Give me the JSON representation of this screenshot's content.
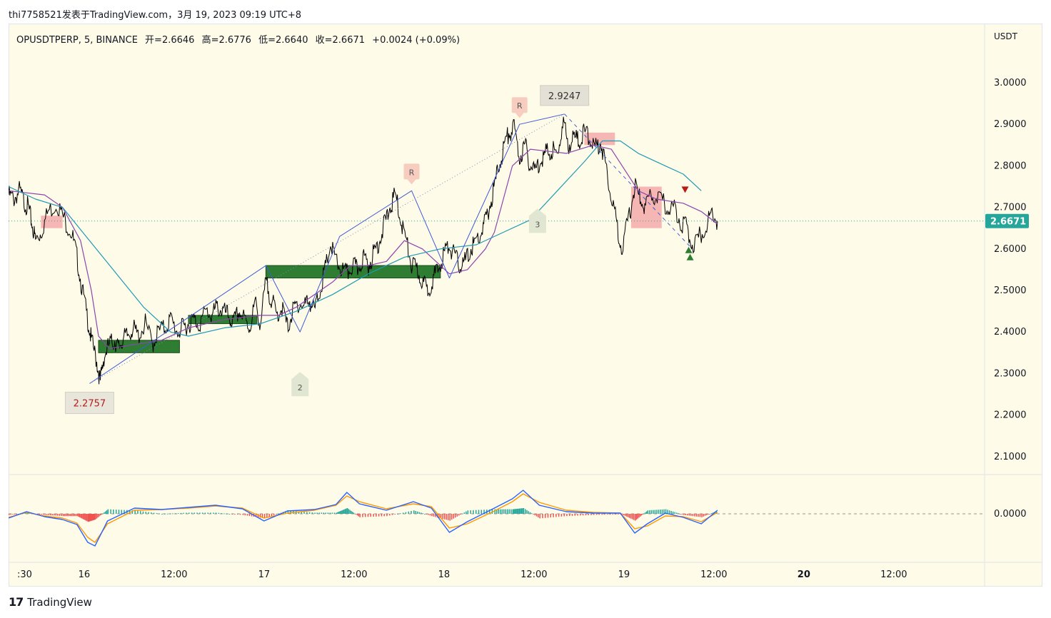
{
  "caption": "thi7758521发表于TradingView.com，3月 19, 2023 09:19 UTC+8",
  "legend": {
    "symbol": "OPUSDTPERP, 5, BINANCE",
    "open": "开=2.6646",
    "high": "高=2.6776",
    "low": "低=2.6640",
    "close": "收=2.6671",
    "change": "+0.0024 (+0.09%)"
  },
  "currency": "USDT",
  "last_price": "2.6671",
  "footer_brand": "TradingView",
  "colors": {
    "background": "#fefbe8",
    "candle": "#000000",
    "ma_fast": "#8e44ad",
    "ma_slow": "#1e9bb5",
    "zigzag": "#3f5bd6",
    "demand_zone": "#2e7d32",
    "supply_zone": "#f4a6a6",
    "price_tag": "#26a69a",
    "macd_line": "#2962ff",
    "signal_line": "#ff9800",
    "hist_up": "#26a69a",
    "hist_down": "#ef5350"
  },
  "chart_data": {
    "type": "line",
    "title": "OPUSDTPERP, 5, BINANCE",
    "ylabel": "USDT",
    "ylim": [
      2.05,
      3.06
    ],
    "y_ticks": [
      "3.0000",
      "2.9000",
      "2.8000",
      "2.7000",
      "2.6000",
      "2.5000",
      "2.4000",
      "2.3000",
      "2.2000",
      "2.1000"
    ],
    "x_ticks": [
      ":30",
      "16",
      "12:00",
      "17",
      "12:00",
      "18",
      "12:00",
      "19",
      "12:00",
      "20",
      "12:00"
    ],
    "x_ticks_bold": [
      "20"
    ],
    "series": [
      {
        "kind": "price",
        "x": [
          0,
          0.03,
          0.06,
          0.09,
          0.11,
          0.13,
          0.15,
          0.18,
          0.22,
          0.27,
          0.31,
          0.35,
          0.38,
          0.41,
          0.44,
          0.46,
          0.49,
          0.51,
          0.53,
          0.56,
          0.59,
          0.61,
          0.63,
          0.66,
          0.69,
          0.72,
          0.76,
          0.8,
          0.83,
          0.87,
          0.9,
          0.94,
          0.97,
          1.0,
          1.03,
          1.06,
          1.1,
          1.13,
          1.16,
          1.19,
          1.22,
          1.25,
          1.28,
          1.31,
          1.34,
          1.37,
          1.4,
          1.43,
          1.46,
          1.49,
          1.52,
          1.55,
          1.58,
          1.61,
          1.64,
          1.67,
          1.7,
          1.73,
          1.76,
          1.79,
          1.82,
          1.85,
          1.88,
          1.91,
          1.94,
          1.97,
          2.0,
          2.03,
          2.06,
          2.09,
          2.12,
          2.15,
          2.18,
          2.21,
          2.24,
          2.27,
          2.3,
          2.33,
          2.36,
          2.39,
          2.42,
          2.45,
          2.48,
          2.51,
          2.54,
          2.57,
          2.6,
          2.63,
          2.66,
          2.69,
          2.72,
          2.75,
          2.78,
          2.81,
          2.84,
          2.87,
          2.9,
          2.93,
          2.96,
          2.99,
          3.02,
          3.05,
          3.08,
          3.11,
          3.14,
          3.17,
          3.2,
          3.23,
          3.26,
          3.29,
          3.32,
          3.35,
          3.38,
          3.41,
          3.45,
          3.48,
          3.51,
          3.54,
          3.58,
          3.62,
          3.66,
          3.7,
          3.73,
          3.77,
          3.8,
          3.84,
          3.88,
          3.91,
          3.94
        ],
        "values": [
          2.73,
          2.72,
          2.74,
          2.71,
          2.7,
          2.66,
          2.62,
          2.64,
          2.69,
          2.71,
          2.67,
          2.64,
          2.58,
          2.5,
          2.43,
          2.38,
          2.33,
          2.28,
          2.34,
          2.37,
          2.38,
          2.36,
          2.38,
          2.39,
          2.41,
          2.39,
          2.42,
          2.37,
          2.4,
          2.41,
          2.43,
          2.4,
          2.41,
          2.42,
          2.43,
          2.42,
          2.45,
          2.44,
          2.46,
          2.45,
          2.44,
          2.42,
          2.45,
          2.43,
          2.41,
          2.47,
          2.42,
          2.52,
          2.48,
          2.44,
          2.46,
          2.41,
          2.45,
          2.47,
          2.46,
          2.48,
          2.45,
          2.5,
          2.55,
          2.61,
          2.57,
          2.55,
          2.54,
          2.56,
          2.55,
          2.58,
          2.56,
          2.59,
          2.62,
          2.66,
          2.7,
          2.73,
          2.67,
          2.62,
          2.56,
          2.55,
          2.52,
          2.5,
          2.53,
          2.55,
          2.59,
          2.61,
          2.58,
          2.56,
          2.57,
          2.6,
          2.62,
          2.64,
          2.68,
          2.73,
          2.79,
          2.84,
          2.88,
          2.89,
          2.82,
          2.85,
          2.8,
          2.79,
          2.82,
          2.83,
          2.84,
          2.82,
          2.91,
          2.85,
          2.87,
          2.86,
          2.88,
          2.87,
          2.84,
          2.86,
          2.8,
          2.73,
          2.66,
          2.6,
          2.68,
          2.75,
          2.72,
          2.7,
          2.73,
          2.72,
          2.7,
          2.7,
          2.67,
          2.65,
          2.61,
          2.63,
          2.66,
          2.69,
          2.667
        ]
      },
      {
        "kind": "ma_fast",
        "x": [
          0,
          0.2,
          0.3,
          0.4,
          0.46,
          0.5,
          0.56,
          0.7,
          0.85,
          1.0,
          1.2,
          1.4,
          1.5,
          1.6,
          1.8,
          1.9,
          2.0,
          2.1,
          2.2,
          2.3,
          2.45,
          2.55,
          2.65,
          2.7,
          2.75,
          2.8,
          2.9,
          3.1,
          3.25,
          3.35,
          3.5,
          3.6,
          3.75,
          3.85,
          3.94
        ],
        "values": [
          2.74,
          2.73,
          2.7,
          2.62,
          2.5,
          2.39,
          2.36,
          2.37,
          2.38,
          2.41,
          2.43,
          2.44,
          2.44,
          2.46,
          2.52,
          2.56,
          2.56,
          2.57,
          2.62,
          2.6,
          2.54,
          2.55,
          2.6,
          2.64,
          2.72,
          2.8,
          2.84,
          2.83,
          2.85,
          2.84,
          2.74,
          2.72,
          2.71,
          2.69,
          2.66
        ]
      },
      {
        "kind": "ma_slow",
        "x": [
          0,
          0.15,
          0.3,
          0.45,
          0.6,
          0.75,
          0.9,
          1.0,
          1.2,
          1.4,
          1.6,
          1.8,
          2.0,
          2.2,
          2.4,
          2.6,
          2.75,
          2.9,
          3.05,
          3.2,
          3.3,
          3.4,
          3.5,
          3.65,
          3.75,
          3.85
        ],
        "values": [
          2.75,
          2.72,
          2.7,
          2.62,
          2.54,
          2.46,
          2.4,
          2.39,
          2.41,
          2.42,
          2.45,
          2.49,
          2.54,
          2.58,
          2.6,
          2.61,
          2.64,
          2.67,
          2.74,
          2.81,
          2.86,
          2.86,
          2.83,
          2.8,
          2.78,
          2.74
        ]
      },
      {
        "kind": "zigzag",
        "x": [
          0.45,
          1.43,
          1.62,
          1.84,
          2.24,
          2.45,
          2.84,
          3.09
        ],
        "values": [
          2.2757,
          2.56,
          2.4,
          2.63,
          2.74,
          2.53,
          2.9,
          2.9247
        ]
      },
      {
        "kind": "trendline_dotted",
        "x": [
          0.45,
          3.09
        ],
        "values": [
          2.2757,
          2.9247
        ]
      },
      {
        "kind": "trendline_dashed",
        "x": [
          3.09,
          3.8
        ],
        "values": [
          2.9247,
          2.6
        ]
      }
    ],
    "zones": [
      {
        "kind": "demand",
        "x": [
          0.5,
          0.95
        ],
        "y": [
          2.35,
          2.38
        ]
      },
      {
        "kind": "demand",
        "x": [
          1.0,
          1.38
        ],
        "y": [
          2.42,
          2.44
        ]
      },
      {
        "kind": "demand",
        "x": [
          1.43,
          2.4
        ],
        "y": [
          2.53,
          2.56
        ]
      },
      {
        "kind": "supply",
        "x": [
          0.18,
          0.3
        ],
        "y": [
          2.65,
          2.68
        ]
      },
      {
        "kind": "supply",
        "x": [
          3.2,
          3.37
        ],
        "y": [
          2.85,
          2.88
        ]
      },
      {
        "kind": "supply",
        "x": [
          3.46,
          3.63
        ],
        "y": [
          2.65,
          2.75
        ]
      }
    ],
    "annotations": [
      {
        "text": "2.2757",
        "x": 0.45,
        "y": 2.2757,
        "style": "low-label"
      },
      {
        "text": "2.9247",
        "x": 3.09,
        "y": 2.9247,
        "style": "high-label"
      },
      {
        "text": "R",
        "x": 2.24,
        "y": 2.74,
        "style": "r-flag"
      },
      {
        "text": "R",
        "x": 2.84,
        "y": 2.9,
        "style": "r-flag"
      },
      {
        "text": "2",
        "x": 1.62,
        "y": 2.4,
        "style": "wave-num"
      },
      {
        "text": "3",
        "x": 2.94,
        "y": 2.69,
        "style": "wave-num"
      }
    ],
    "signals": [
      {
        "kind": "sell",
        "x": 3.76,
        "y": 2.74
      },
      {
        "kind": "buy",
        "x": 3.78,
        "y": 2.6
      }
    ],
    "oscillator": {
      "type": "macd",
      "zero_label": "0.0000",
      "x": [
        0,
        0.1,
        0.2,
        0.3,
        0.38,
        0.44,
        0.48,
        0.55,
        0.7,
        0.85,
        1.0,
        1.15,
        1.3,
        1.42,
        1.55,
        1.7,
        1.82,
        1.88,
        1.95,
        2.1,
        2.25,
        2.35,
        2.45,
        2.55,
        2.7,
        2.8,
        2.86,
        2.95,
        3.1,
        3.25,
        3.4,
        3.48,
        3.55,
        3.65,
        3.75,
        3.85,
        3.94
      ],
      "macd": [
        -0.006,
        0.003,
        -0.004,
        -0.008,
        -0.015,
        -0.04,
        -0.045,
        -0.01,
        0.008,
        0.006,
        0.009,
        0.012,
        0.007,
        -0.01,
        0.004,
        0.006,
        0.013,
        0.03,
        0.014,
        0.005,
        0.017,
        0.008,
        -0.026,
        -0.011,
        0.008,
        0.021,
        0.033,
        0.012,
        0.003,
        0.001,
        0.001,
        -0.027,
        -0.014,
        0.001,
        -0.005,
        -0.014,
        0.005
      ],
      "signal": [
        -0.005,
        0.002,
        -0.003,
        -0.006,
        -0.013,
        -0.033,
        -0.04,
        -0.014,
        0.005,
        0.006,
        0.008,
        0.011,
        0.008,
        -0.006,
        0.001,
        0.005,
        0.012,
        0.025,
        0.017,
        0.007,
        0.014,
        0.01,
        -0.02,
        -0.014,
        0.004,
        0.017,
        0.028,
        0.016,
        0.005,
        0.002,
        0.001,
        -0.021,
        -0.017,
        -0.003,
        -0.004,
        -0.011,
        0.002
      ]
    }
  }
}
